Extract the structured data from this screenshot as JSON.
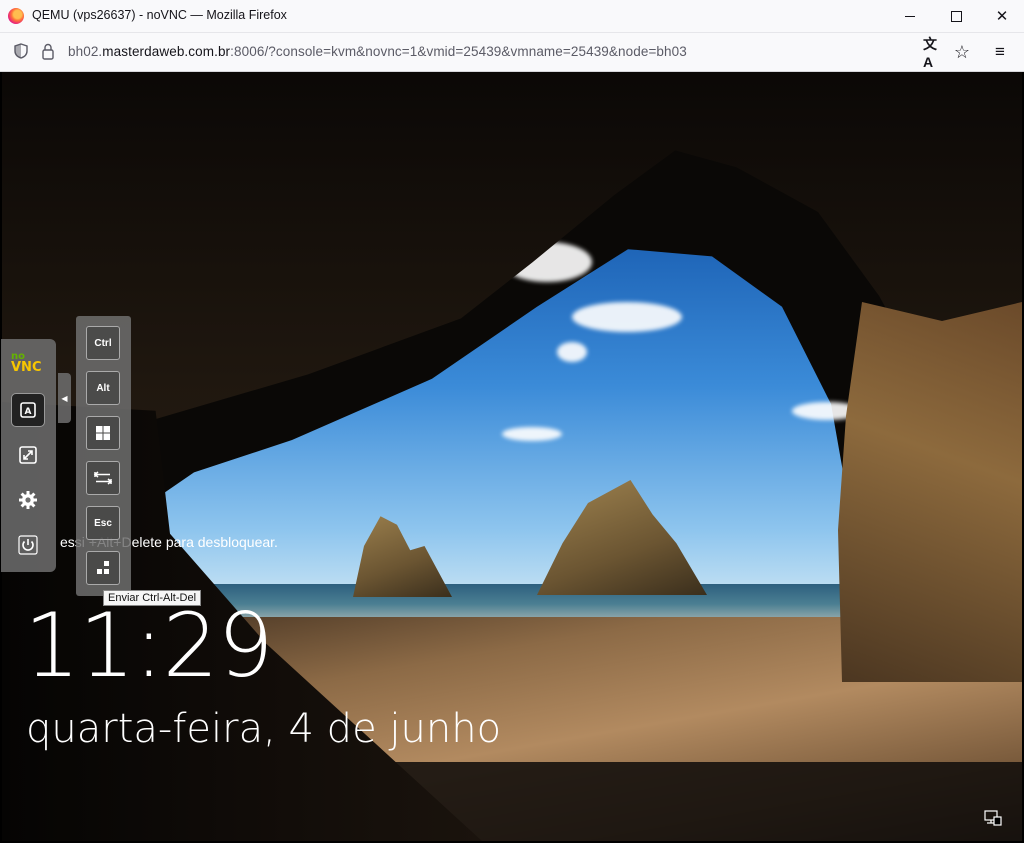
{
  "window": {
    "title": "QEMU (vps26637) - noVNC — Mozilla Firefox",
    "controls": {
      "minimize": "—",
      "maximize": "☐",
      "close": "✕"
    }
  },
  "navbar": {
    "url_prefix": "bh02.",
    "url_host": "masterdaweb.com.br",
    "url_rest": ":8006/?console=kvm&novnc=1&vmid=25439&vmname=25439&node=bh03",
    "icons": [
      "shield-icon",
      "lock-icon",
      "translate-icon",
      "bookmark-star-icon",
      "menu-icon"
    ]
  },
  "lockscreen": {
    "time": "11:29",
    "date": "quarta-feira, 4 de junho",
    "unlock_message": "essi      +Alt+Delete para desbloquear."
  },
  "novnc": {
    "logo_top": "no",
    "logo_bottom": "VNC",
    "sidebar_buttons": [
      "extra-keys-icon",
      "fullscreen-icon",
      "settings-icon",
      "power-icon"
    ],
    "keys": {
      "ctrl": "Ctrl",
      "alt": "Alt",
      "esc": "Esc"
    },
    "tooltip": "Enviar Ctrl-Alt-Del"
  }
}
